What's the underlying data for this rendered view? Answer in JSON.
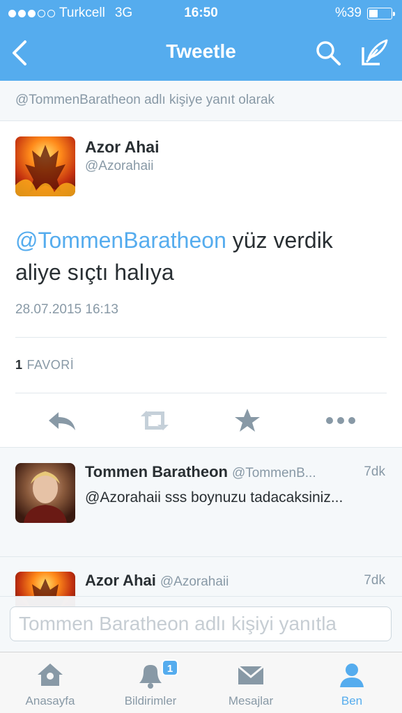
{
  "status_bar": {
    "carrier": "Turkcell",
    "network": "3G",
    "time": "16:50",
    "battery": "%39",
    "battery_level": 0.39
  },
  "nav": {
    "title": "Tweetle",
    "back_icon": "chevron-left-icon",
    "search_icon": "search-icon",
    "compose_icon": "compose-icon"
  },
  "reply_context": "@TommenBaratheon adlı kişiye yanıt olarak",
  "tweet": {
    "author_name": "Azor Ahai",
    "author_handle": "@Azorahaii",
    "mention": "@TommenBaratheon",
    "text_rest": " yüz verdik aliye sıçtı halıya",
    "date": "28.07.2015 16:13",
    "favorites_count": "1",
    "favorites_label": "FAVORİ",
    "actions": [
      "reply-icon",
      "retweet-icon",
      "star-icon",
      "more-icon"
    ]
  },
  "replies": [
    {
      "name": "Tommen Baratheon",
      "handle": "@TommenB...",
      "time": "7dk",
      "text": "@Azorahaii sss boynuzu tadacaksiniz..."
    },
    {
      "name": "Azor Ahai",
      "handle": "@Azorahaii",
      "time": "7dk",
      "text": ""
    }
  ],
  "reply_input": {
    "placeholder": "Tommen Baratheon adlı kişiyi yanıtla"
  },
  "tabbar": {
    "items": [
      {
        "label": "Anasayfa",
        "icon": "home-icon"
      },
      {
        "label": "Bildirimler",
        "icon": "bell-icon",
        "badge": "1"
      },
      {
        "label": "Mesajlar",
        "icon": "envelope-icon"
      },
      {
        "label": "Ben",
        "icon": "person-icon",
        "active": true
      }
    ]
  },
  "colors": {
    "brand": "#55acee",
    "text": "#292f33",
    "muted": "#8899a6"
  }
}
